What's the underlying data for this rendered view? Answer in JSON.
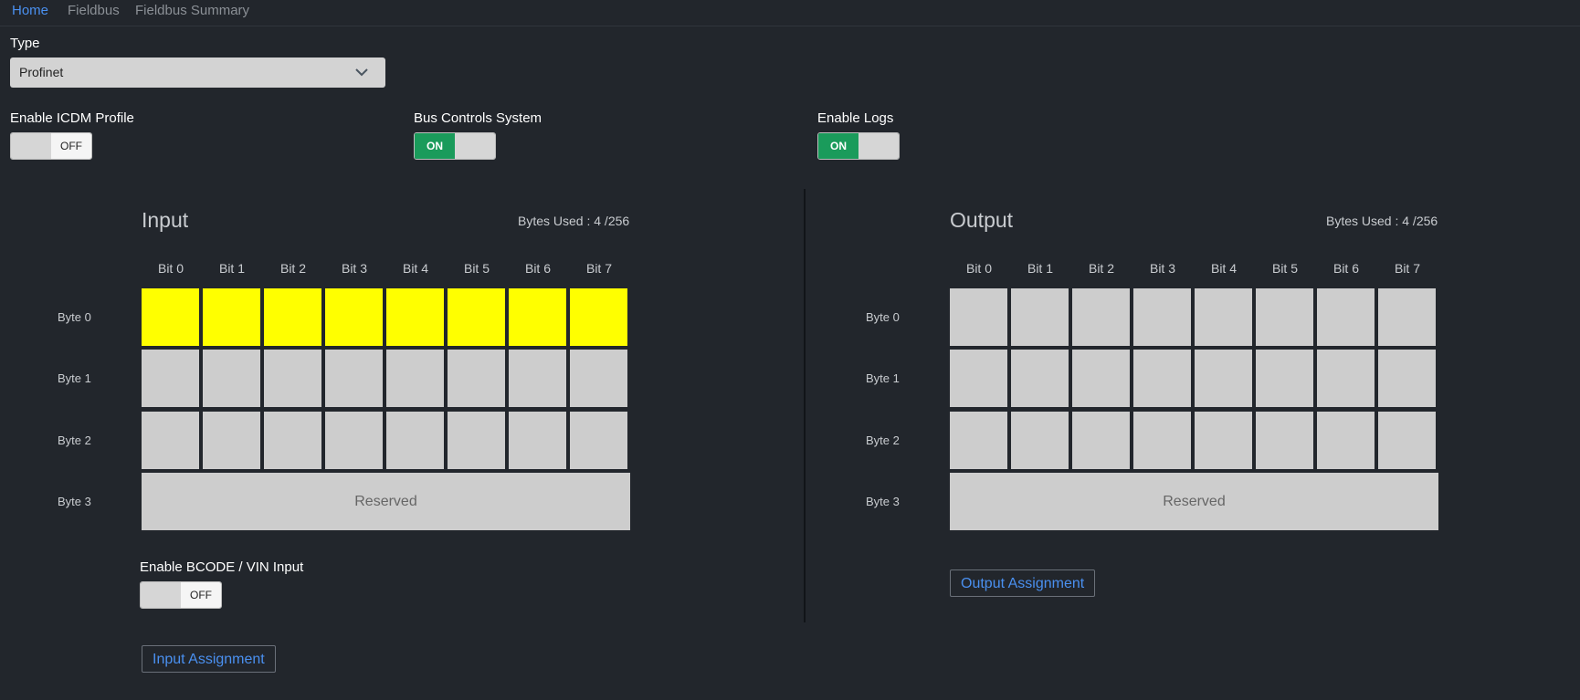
{
  "nav": {
    "items": [
      {
        "label": "Home",
        "active": true
      },
      {
        "label": "Fieldbus",
        "active": false
      },
      {
        "label": "Fieldbus Summary",
        "active": false
      }
    ]
  },
  "type": {
    "label": "Type",
    "selected": "Profinet"
  },
  "toggles": {
    "icdm": {
      "label": "Enable ICDM Profile",
      "state": "OFF"
    },
    "bus_controls": {
      "label": "Bus Controls System",
      "state": "ON"
    },
    "logs": {
      "label": "Enable Logs",
      "state": "ON"
    },
    "bcode": {
      "label": "Enable BCODE / VIN Input",
      "state": "OFF"
    }
  },
  "input": {
    "title": "Input",
    "bytes_used": "Bytes Used : 4 /256",
    "bit_headers": [
      "Bit 0",
      "Bit 1",
      "Bit 2",
      "Bit 3",
      "Bit 4",
      "Bit 5",
      "Bit 6",
      "Bit 7"
    ],
    "byte_labels": [
      "Byte 0",
      "Byte 1",
      "Byte 2",
      "Byte 3"
    ],
    "reserved_label": "Reserved",
    "assignment_button": "Input Assignment"
  },
  "output": {
    "title": "Output",
    "bytes_used": "Bytes Used : 4 /256",
    "bit_headers": [
      "Bit 0",
      "Bit 1",
      "Bit 2",
      "Bit 3",
      "Bit 4",
      "Bit 5",
      "Bit 6",
      "Bit 7"
    ],
    "byte_labels": [
      "Byte 0",
      "Byte 1",
      "Byte 2",
      "Byte 3"
    ],
    "reserved_label": "Reserved",
    "assignment_button": "Output Assignment"
  },
  "colors": {
    "background": "#22262c",
    "assigned_cell": "#ffff00",
    "empty_cell": "#cdcdcd",
    "toggle_on": "#1a9b5b",
    "link": "#4a90f0"
  },
  "icons": {
    "select_arrow": "chevron-down-icon"
  }
}
